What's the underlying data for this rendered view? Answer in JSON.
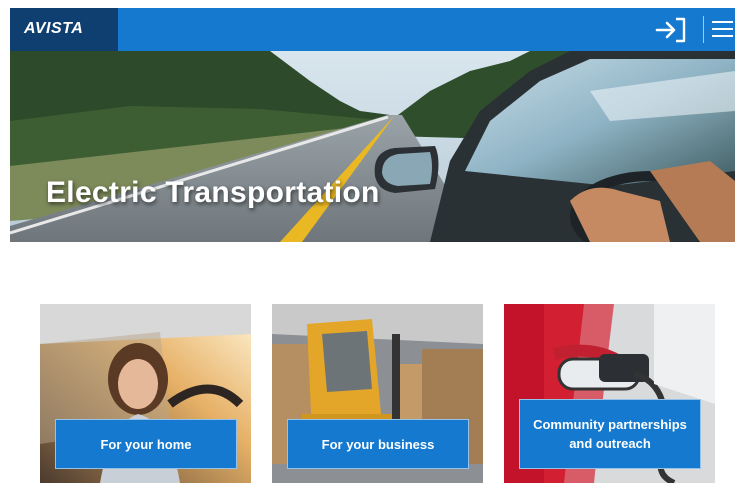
{
  "header": {
    "logo_text": "AVISTA",
    "login_icon": "sign-in-icon",
    "menu_icon": "hamburger-menu-icon",
    "colors": {
      "bar": "#1479cf",
      "logo_bg": "#0e3f70",
      "logo_accent": "#f07d1a"
    }
  },
  "hero": {
    "title": "Electric Transportation"
  },
  "cards": [
    {
      "label": "For your home"
    },
    {
      "label": "For your business"
    },
    {
      "label": "Community partnerships and outreach"
    }
  ]
}
